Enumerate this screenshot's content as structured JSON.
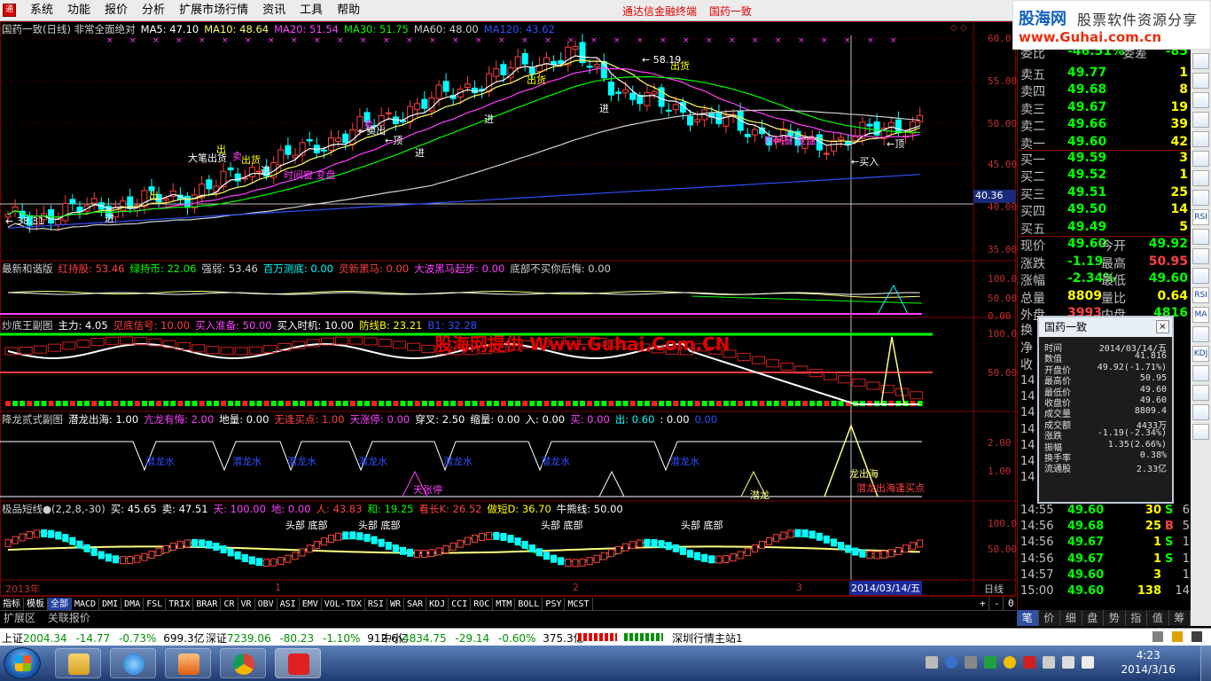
{
  "menu": {
    "items": [
      "系统",
      "功能",
      "报价",
      "分析",
      "扩展市场行情",
      "资讯",
      "工具",
      "帮助"
    ],
    "center_title": [
      "通达信金融终端",
      "国药一致"
    ]
  },
  "logo": {
    "brand": "股海网",
    "slogan": "股票软件资源分享",
    "url": "www.Guhai.com.cn"
  },
  "watermark": "股海网提供 Www.Guhai.Com.CN",
  "main_chart": {
    "header": [
      {
        "t": "国药一致(日线) 非常全面绝对",
        "c": "#d0d0d0"
      },
      {
        "t": "MA5: 47.10",
        "c": "#ffffff"
      },
      {
        "t": "MA10: 48.64",
        "c": "#ffff60"
      },
      {
        "t": "MA20: 51.54",
        "c": "#ff40ff"
      },
      {
        "t": "MA30: 51.75",
        "c": "#00ff00"
      },
      {
        "t": "MA60: 48.00",
        "c": "#d0d0d0"
      },
      {
        "t": "MA120: 43.62",
        "c": "#3050ff"
      }
    ],
    "y_labels": [
      "60.0",
      "55.00",
      "50.00",
      "45.00",
      "40.00",
      "35.00"
    ],
    "current_price_label": "40.36",
    "low_label": "38.31",
    "high_label": "58.19",
    "annotations": [
      {
        "t": "大笔出货",
        "c": "#ffffff"
      },
      {
        "t": "出",
        "c": "#ffff00"
      },
      {
        "t": "卖",
        "c": "#ff40ff"
      },
      {
        "t": "出货",
        "c": "#ffff00"
      },
      {
        "t": "←卖出",
        "c": "#ffffff"
      },
      {
        "t": "卖",
        "c": "#ff40ff"
      },
      {
        "t": "←顶",
        "c": "#ffffff"
      },
      {
        "t": "出货",
        "c": "#ffff00"
      },
      {
        "t": "出货",
        "c": "#ffff00"
      },
      {
        "t": "出",
        "c": "#ffff00"
      },
      {
        "t": "进",
        "c": "#ffffff"
      },
      {
        "t": "进",
        "c": "#ffffff"
      },
      {
        "t": "进",
        "c": "#ffffff"
      },
      {
        "t": "进",
        "c": "#ffffff"
      },
      {
        "t": "进",
        "c": "#ffffff"
      },
      {
        "t": "时间窗 变盘",
        "c": "#ff40ff"
      },
      {
        "t": "时间窗 变盘",
        "c": "#ff40ff"
      },
      {
        "t": "←买入",
        "c": "#ffffff"
      },
      {
        "t": "←顶",
        "c": "#ffffff"
      }
    ]
  },
  "panel1": {
    "header": [
      {
        "t": "最新和谐版",
        "c": "#d0d0d0"
      },
      {
        "t": "红持股: 53.46",
        "c": "#ff4040"
      },
      {
        "t": "绿持币: 22.06",
        "c": "#00ff00"
      },
      {
        "t": "强弱: 53.46",
        "c": "#d0d0d0"
      },
      {
        "t": "百万测底: 0.00",
        "c": "#00ffff"
      },
      {
        "t": "灵新黑马: 0.00",
        "c": "#ff4040"
      },
      {
        "t": "大波黑马起步: 0.00",
        "c": "#ff40ff"
      },
      {
        "t": "底部不买你后悔: 0.00",
        "c": "#d0d0d0"
      }
    ],
    "y_labels": [
      "100.0",
      "50.00",
      "0.00"
    ]
  },
  "panel2": {
    "header": [
      {
        "t": "炒底王副图",
        "c": "#d0d0d0"
      },
      {
        "t": "主力: 4.05",
        "c": "#ffffff"
      },
      {
        "t": "见底信号: 10.00",
        "c": "#ff4040"
      },
      {
        "t": "买入准备: 50.00",
        "c": "#ff40ff"
      },
      {
        "t": "买入时机: 10.00",
        "c": "#ffffff"
      },
      {
        "t": "防线B: 23.21",
        "c": "#ffff00"
      },
      {
        "t": "B1: 32.28",
        "c": "#3050ff"
      }
    ],
    "y_labels": [
      "100.0",
      "50.00"
    ]
  },
  "panel3": {
    "header": [
      {
        "t": "降龙贰式副图",
        "c": "#d0d0d0"
      },
      {
        "t": "潜龙出海: 1.00",
        "c": "#ffffff"
      },
      {
        "t": "亢龙有悔: 2.00",
        "c": "#ff40ff"
      },
      {
        "t": "地量: 0.00",
        "c": "#ffffff"
      },
      {
        "t": "无逢买点: 1.00",
        "c": "#ff4040"
      },
      {
        "t": "天涨停: 0.00",
        "c": "#ff40ff"
      },
      {
        "t": "穿叉: 2.50",
        "c": "#ffffff"
      },
      {
        "t": "缩量: 0.00",
        "c": "#ffffff"
      },
      {
        "t": "入: 0.00",
        "c": "#ffffff"
      },
      {
        "t": "买: 0.00",
        "c": "#ff40ff"
      },
      {
        "t": "出: 0.60",
        "c": "#00ffff"
      },
      {
        "t": ": 0.00",
        "c": "#ffffff"
      },
      {
        "t": "0.00",
        "c": "#3050ff"
      }
    ],
    "y_labels": [
      "2.00",
      "1.00"
    ],
    "labels": [
      "潜龙水",
      "潜龙水",
      "潜龙水",
      "潜龙水",
      "潜龙水",
      "潜龙水",
      "潜龙水",
      "天张停",
      "龙出海",
      "潜龙",
      "潜龙出海逢买点"
    ]
  },
  "panel4": {
    "header": [
      {
        "t": "极品短线●(2,2,8,-30)",
        "c": "#d0d0d0"
      },
      {
        "t": "买: 45.65",
        "c": "#ffffff"
      },
      {
        "t": "卖: 47.51",
        "c": "#ffffff"
      },
      {
        "t": "天: 100.00",
        "c": "#ff40ff"
      },
      {
        "t": "地: 0.00",
        "c": "#ff40ff"
      },
      {
        "t": "人: 43.83",
        "c": "#ff4040"
      },
      {
        "t": "和: 19.25",
        "c": "#00ff00"
      },
      {
        "t": "看长K: 26.52",
        "c": "#ff4040"
      },
      {
        "t": "做短D: 36.70",
        "c": "#ffff00"
      },
      {
        "t": "牛熊线: 50.00",
        "c": "#ffffff"
      }
    ],
    "y_labels": [
      "100.0",
      "50.00"
    ],
    "labels": [
      "头部 底部",
      "头部 底部",
      "头部 底部",
      "头部 底部"
    ]
  },
  "x_axis": {
    "year": "2013年",
    "months": [
      "1",
      "2",
      "3"
    ],
    "cursor_date": "2014/03/14/五",
    "period": "日线"
  },
  "indicator_tabs": [
    "指标",
    "模板",
    "全部",
    "MACD",
    "DMI",
    "DMA",
    "FSL",
    "TRIX",
    "BRAR",
    "CR",
    "VR",
    "OBV",
    "ASI",
    "EMV",
    "VOL-TDX",
    "RSI",
    "WR",
    "SAR",
    "KDJ",
    "CCI",
    "ROC",
    "MTM",
    "BOLL",
    "PSY",
    "MCST"
  ],
  "active_tab": "全部",
  "tab_controls": [
    "+",
    "-",
    "0"
  ],
  "ext_bar": [
    "扩展区",
    "关联报价"
  ],
  "quote": {
    "top_partial": {
      "label": "委比",
      "value": "-46.51%",
      "label2": "委差",
      "value2": "-85"
    },
    "sells": [
      {
        "lb": "卖五",
        "pr": "49.77",
        "vol": "1"
      },
      {
        "lb": "卖四",
        "pr": "49.68",
        "vol": "8"
      },
      {
        "lb": "卖三",
        "pr": "49.67",
        "vol": "19"
      },
      {
        "lb": "卖二",
        "pr": "49.66",
        "vol": "39"
      },
      {
        "lb": "卖一",
        "pr": "49.60",
        "vol": "42"
      }
    ],
    "buys": [
      {
        "lb": "买一",
        "pr": "49.59",
        "vol": "3"
      },
      {
        "lb": "买二",
        "pr": "49.52",
        "vol": "1"
      },
      {
        "lb": "买三",
        "pr": "49.51",
        "vol": "25"
      },
      {
        "lb": "买四",
        "pr": "49.50",
        "vol": "14"
      },
      {
        "lb": "买五",
        "pr": "49.49",
        "vol": "5"
      }
    ],
    "stats": [
      {
        "l1": "现价",
        "v1": "49.60",
        "c1": "#00ff00",
        "l2": "今开",
        "v2": "49.92",
        "c2": "#00ff00"
      },
      {
        "l1": "涨跌",
        "v1": "-1.19",
        "c1": "#00ff00",
        "l2": "最高",
        "v2": "50.95",
        "c2": "#ff4040"
      },
      {
        "l1": "涨幅",
        "v1": "-2.34%",
        "c1": "#00ff00",
        "l2": "最低",
        "v2": "49.60",
        "c2": "#00ff00"
      },
      {
        "l1": "总量",
        "v1": "8809",
        "c1": "#ffff00",
        "l2": "量比",
        "v2": "0.64",
        "c2": "#ffff00"
      },
      {
        "l1": "外盘",
        "v1": "3993",
        "c1": "#ff4040",
        "l2": "内盘",
        "v2": "4816",
        "c2": "#00ff00"
      }
    ],
    "partial_labels": [
      "换",
      "净",
      "收"
    ],
    "ticks": [
      {
        "t": "14:55",
        "p": "49.60",
        "pc": "#00ff00",
        "v": "30",
        "d": "S",
        "dc": "#00ff00"
      },
      {
        "t": "14:56",
        "p": "49.68",
        "pc": "#00ff00",
        "v": "25",
        "d": "B",
        "dc": "#ff4040"
      },
      {
        "t": "14:56",
        "p": "49.67",
        "pc": "#00ff00",
        "v": "1",
        "d": "S",
        "dc": "#00ff00"
      },
      {
        "t": "14:56",
        "p": "49.67",
        "pc": "#00ff00",
        "v": "1",
        "d": "S",
        "dc": "#00ff00"
      },
      {
        "t": "14:57",
        "p": "49.60",
        "pc": "#00ff00",
        "v": "3",
        "d": "",
        "dc": "#00ff00"
      },
      {
        "t": "15:00",
        "p": "49.60",
        "pc": "#00ff00",
        "v": "138",
        "d": "",
        "dc": "#00ff00"
      }
    ],
    "tick_extra": [
      "6",
      "5",
      "1",
      "1",
      "1",
      "14"
    ],
    "tabs": [
      "笔",
      "价",
      "细",
      "盘",
      "势",
      "指",
      "值",
      "筹"
    ]
  },
  "popup": {
    "title": "国药一致",
    "rows": [
      {
        "k": "时间",
        "v": "2014/03/14/五"
      },
      {
        "k": "数值",
        "v": "41.816"
      },
      {
        "k": "开盘价",
        "v": "49.92(-1.71%)"
      },
      {
        "k": "最高价",
        "v": "50.95"
      },
      {
        "k": "最低价",
        "v": "49.60"
      },
      {
        "k": "收盘价",
        "v": "49.60"
      },
      {
        "k": "成交量",
        "v": "8809.4"
      },
      {
        "k": "成交额",
        "v": "4433万"
      },
      {
        "k": "涨跌",
        "v": "-1.19(-2.34%)"
      },
      {
        "k": "振幅",
        "v": "1.35(2.66%)"
      },
      {
        "k": "换手率",
        "v": "0.38%"
      },
      {
        "k": "流通股",
        "v": "2.33亿"
      }
    ]
  },
  "status": {
    "sh": {
      "name": "上证",
      "val": "2004.34",
      "chg": "-14.77",
      "pct": "-0.73%",
      "amt": "699.3亿"
    },
    "sz": {
      "name": "深证",
      "val": "7239.06",
      "chg": "-80.23",
      "pct": "-1.10%",
      "amt": "912.6亿"
    },
    "zx": {
      "name": "中小",
      "val": "4834.75",
      "chg": "-29.14",
      "pct": "-0.60%",
      "amt": "375.3亿"
    },
    "server": "深圳行情主站1"
  },
  "clock": {
    "time": "4:23",
    "date": "2014/3/16"
  },
  "side_tools": [
    "RSI",
    "MA",
    "KDJ"
  ],
  "colors": {
    "up": "#ff4040",
    "down": "#00ffff",
    "grid": "#800000",
    "bg": "#000000"
  }
}
